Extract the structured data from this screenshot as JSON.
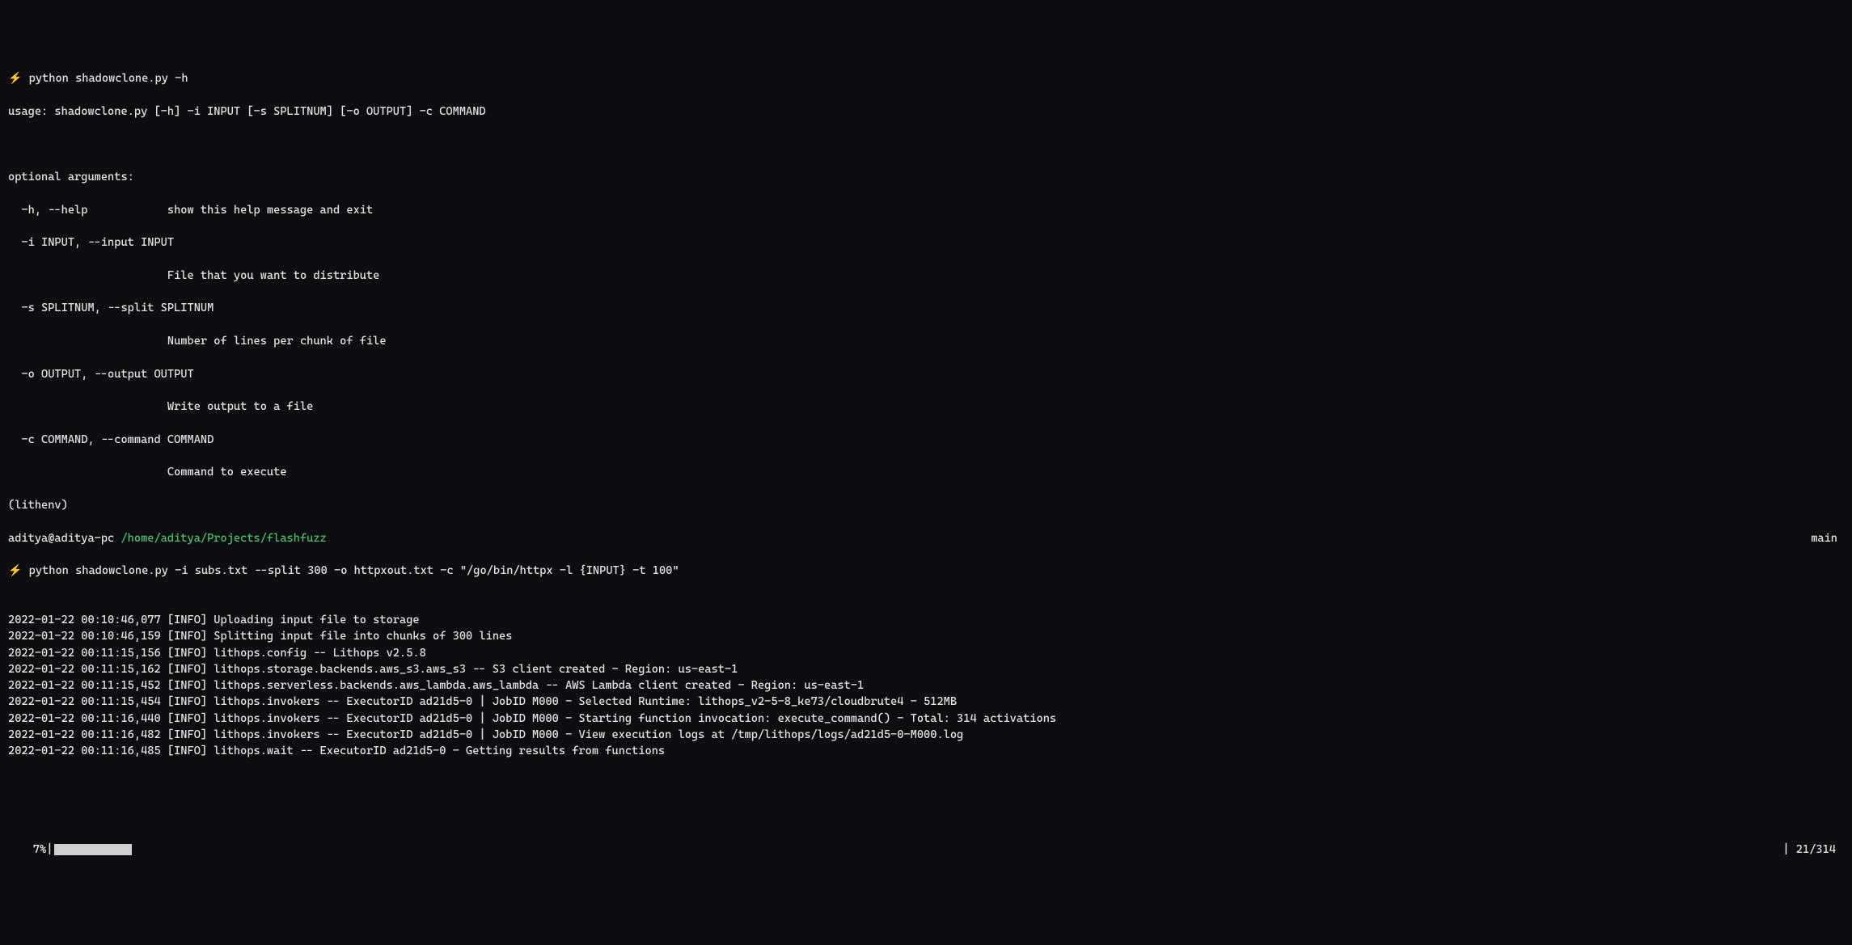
{
  "cmd1": {
    "bolt": "⚡",
    "text": " python shadowclone.py -h"
  },
  "help": {
    "usage": "usage: shadowclone.py [-h] -i INPUT [-s SPLITNUM] [-o OUTPUT] -c COMMAND",
    "header": "optional arguments:",
    "h_flag": "  -h, --help            show this help message and exit",
    "i_flag": "  -i INPUT, --input INPUT",
    "i_desc": "                        File that you want to distribute",
    "s_flag": "  -s SPLITNUM, --split SPLITNUM",
    "s_desc": "                        Number of lines per chunk of file",
    "o_flag": "  -o OUTPUT, --output OUTPUT",
    "o_desc": "                        Write output to a file",
    "c_flag": "  -c COMMAND, --command COMMAND",
    "c_desc": "                        Command to execute"
  },
  "env": "(lithenv)",
  "prompt": {
    "user": "aditya@aditya-pc ",
    "path": "/home/aditya/Projects/flashfuzz",
    "branch": "main"
  },
  "cmd2": {
    "bolt": "⚡",
    "text": " python shadowclone.py -i subs.txt --split 300 -o httpxout.txt -c \"/go/bin/httpx -l {INPUT} -t 100\""
  },
  "logs": [
    "2022-01-22 00:10:46,077 [INFO] Uploading input file to storage",
    "2022-01-22 00:10:46,159 [INFO] Splitting input file into chunks of 300 lines",
    "2022-01-22 00:11:15,156 [INFO] lithops.config -- Lithops v2.5.8",
    "2022-01-22 00:11:15,162 [INFO] lithops.storage.backends.aws_s3.aws_s3 -- S3 client created - Region: us-east-1",
    "2022-01-22 00:11:15,452 [INFO] lithops.serverless.backends.aws_lambda.aws_lambda -- AWS Lambda client created - Region: us-east-1",
    "2022-01-22 00:11:15,454 [INFO] lithops.invokers -- ExecutorID ad21d5-0 | JobID M000 - Selected Runtime: lithops_v2-5-8_ke73/cloudbrute4 - 512MB",
    "2022-01-22 00:11:16,440 [INFO] lithops.invokers -- ExecutorID ad21d5-0 | JobID M000 - Starting function invocation: execute_command() - Total: 314 activations",
    "2022-01-22 00:11:16,482 [INFO] lithops.invokers -- ExecutorID ad21d5-0 | JobID M000 - View execution logs at /tmp/lithops/logs/ad21d5-0-M000.log",
    "2022-01-22 00:11:16,485 [INFO] lithops.wait -- ExecutorID ad21d5-0 - Getting results from functions"
  ],
  "progress": {
    "pct_label": "7%",
    "pct_value": 7,
    "done": 21,
    "total": 314,
    "right_label": "| 21/314"
  }
}
